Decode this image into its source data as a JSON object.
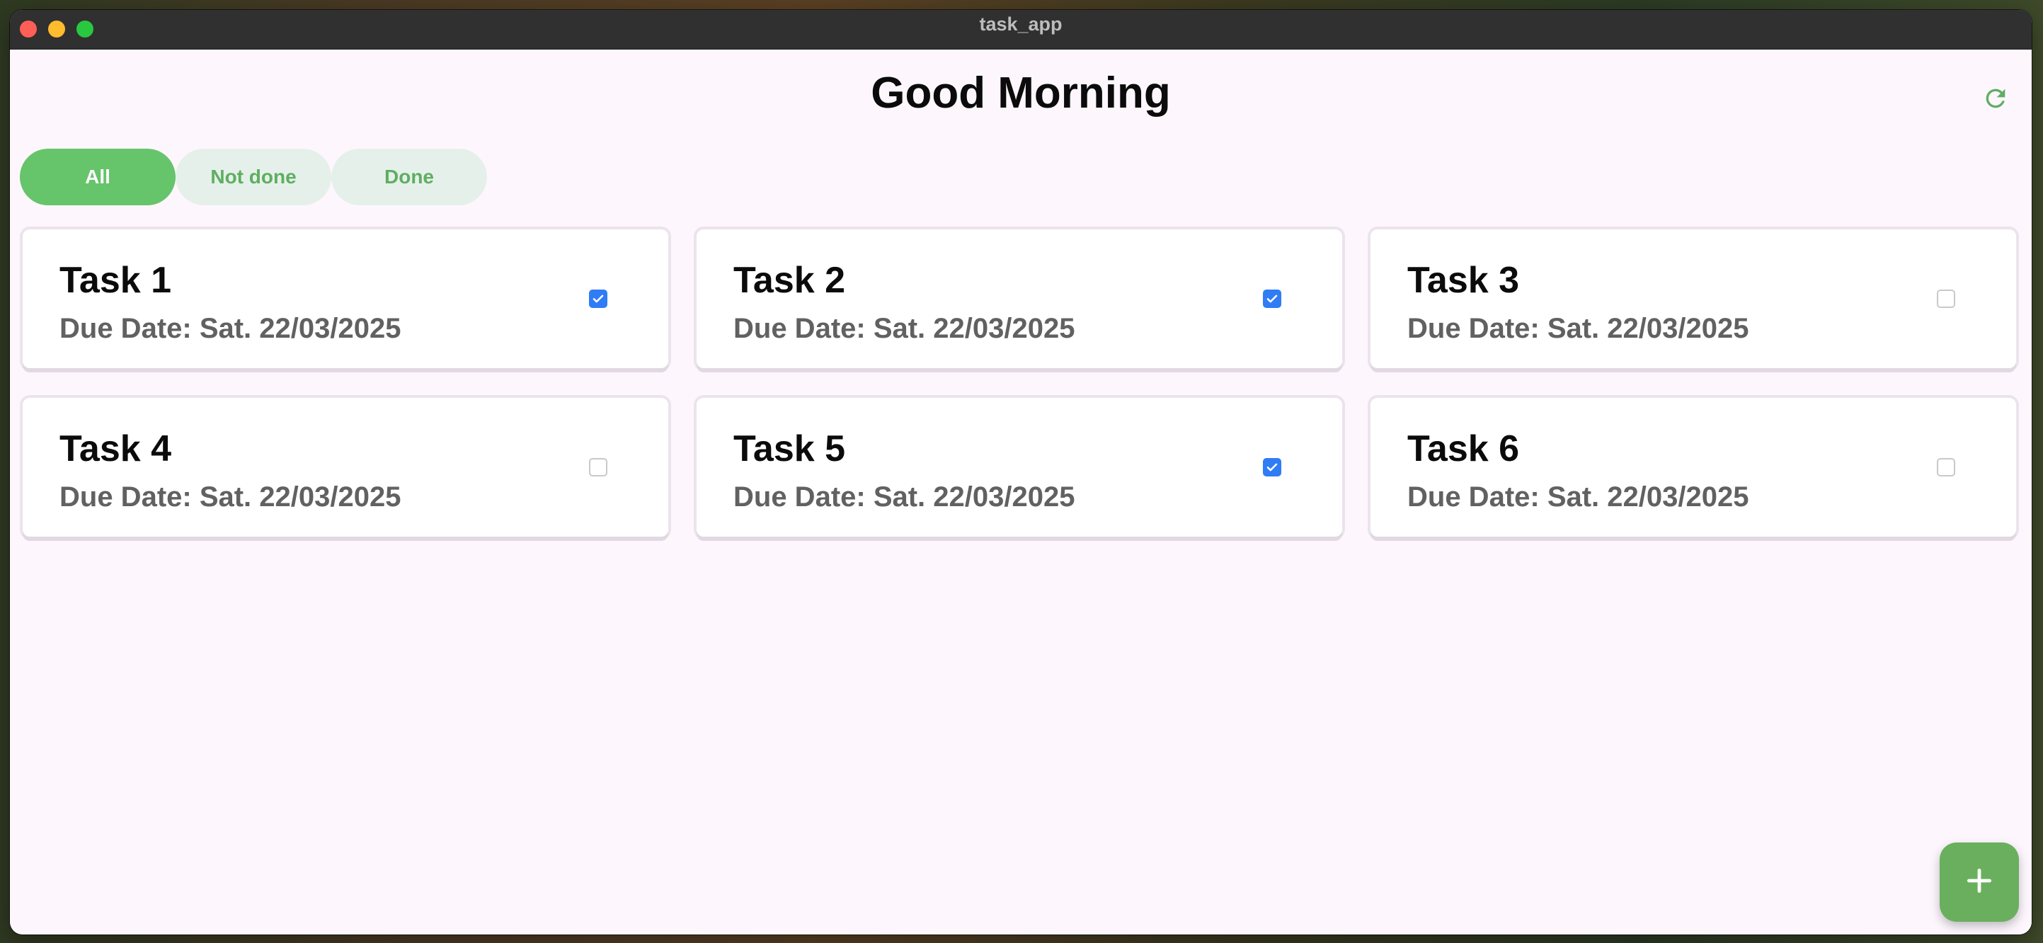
{
  "window": {
    "title": "task_app"
  },
  "header": {
    "greeting": "Good Morning",
    "refresh_icon": "refresh-icon"
  },
  "filters": [
    {
      "label": "All",
      "active": true
    },
    {
      "label": "Not done",
      "active": false
    },
    {
      "label": "Done",
      "active": false
    }
  ],
  "tasks": [
    {
      "title": "Task 1",
      "due": "Due Date: Sat. 22/03/2025",
      "done": true
    },
    {
      "title": "Task 2",
      "due": "Due Date: Sat. 22/03/2025",
      "done": true
    },
    {
      "title": "Task 3",
      "due": "Due Date: Sat. 22/03/2025",
      "done": false
    },
    {
      "title": "Task 4",
      "due": "Due Date: Sat. 22/03/2025",
      "done": false
    },
    {
      "title": "Task 5",
      "due": "Due Date: Sat. 22/03/2025",
      "done": true
    },
    {
      "title": "Task 6",
      "due": "Due Date: Sat. 22/03/2025",
      "done": false
    }
  ],
  "fab": {
    "icon": "plus-icon"
  },
  "colors": {
    "accent": "#66c46b",
    "chip_inactive_bg": "#e6f0ea",
    "chip_inactive_text": "#5fae62",
    "checkbox_checked": "#2f7cf5",
    "fab": "#6aaf5e",
    "background": "#fdf7fd"
  }
}
